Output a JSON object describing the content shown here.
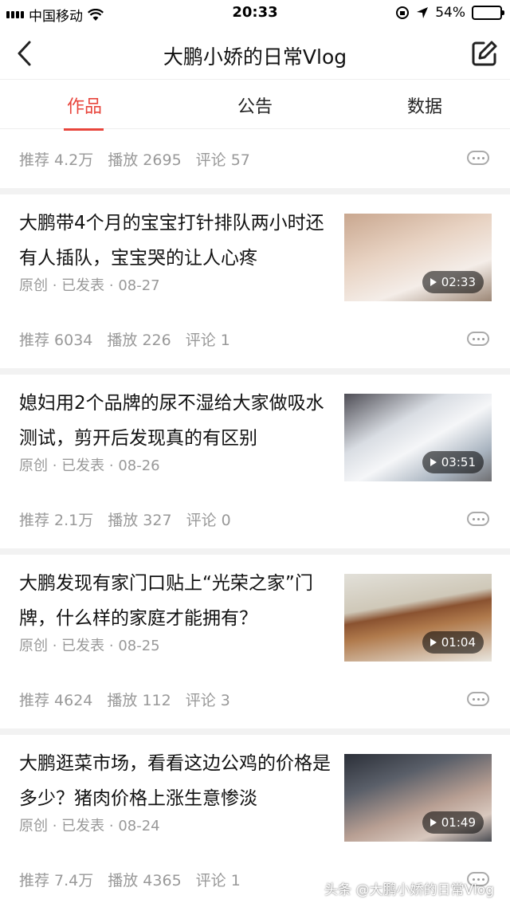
{
  "status_bar": {
    "carrier": "中国移动",
    "time": "20:33",
    "battery": "54%",
    "battery_level": 0.54
  },
  "header": {
    "title": "大鹏小娇的日常Vlog",
    "back_icon": "chevron-left-icon",
    "edit_icon": "edit-icon"
  },
  "tabs": [
    {
      "label": "作品",
      "active": true
    },
    {
      "label": "公告",
      "active": false
    },
    {
      "label": "数据",
      "active": false
    }
  ],
  "top_stats": {
    "recommend": "推荐 4.2万",
    "plays": "播放 2695",
    "comments": "评论 57"
  },
  "articles": [
    {
      "title": "大鹏带4个月的宝宝打针排队两小时还有人插队，宝宝哭的让人心疼",
      "meta": "原创 · 已发表 · 08-27",
      "duration": "02:33",
      "recommend": "推荐 6034",
      "plays": "播放 226",
      "comments": "评论 1"
    },
    {
      "title": "媳妇用2个品牌的尿不湿给大家做吸水测试，剪开后发现真的有区别",
      "meta": "原创 · 已发表 · 08-26",
      "duration": "03:51",
      "recommend": "推荐 2.1万",
      "plays": "播放 327",
      "comments": "评论 0"
    },
    {
      "title": "大鹏发现有家门口贴上“光荣之家”门牌，什么样的家庭才能拥有？",
      "meta": "原创 · 已发表 · 08-25",
      "duration": "01:04",
      "recommend": "推荐 4624",
      "plays": "播放 112",
      "comments": "评论 3"
    },
    {
      "title": "大鹏逛菜市场，看看这边公鸡的价格是多少？猪肉价格上涨生意惨淡",
      "meta": "原创 · 已发表 · 08-24",
      "duration": "01:49",
      "recommend": "推荐 7.4万",
      "plays": "播放 4365",
      "comments": "评论 1"
    }
  ],
  "watermark": "头条 @大鹏小娇的日常Vlog"
}
